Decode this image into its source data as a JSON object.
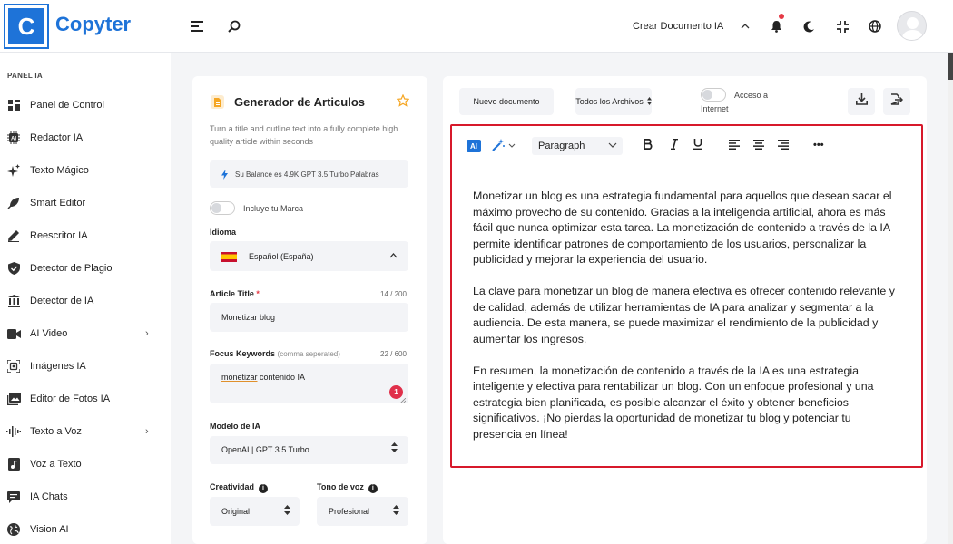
{
  "app": {
    "logo_letter": "C",
    "name": "Copyter"
  },
  "header": {
    "create_label": "Crear Documento IA"
  },
  "sidebar": {
    "section_label": "PANEL IA",
    "items": [
      {
        "label": "Panel de Control",
        "icon": "grid-icon"
      },
      {
        "label": "Redactor IA",
        "icon": "ai-chip-icon"
      },
      {
        "label": "Texto Mágico",
        "icon": "sparkle-icon"
      },
      {
        "label": "Smart Editor",
        "icon": "feather-icon"
      },
      {
        "label": "Reescritor IA",
        "icon": "pen-icon"
      },
      {
        "label": "Detector de Plagio",
        "icon": "shield-icon"
      },
      {
        "label": "Detector de IA",
        "icon": "building-icon"
      },
      {
        "label": "AI Video",
        "icon": "video-icon",
        "chevron": "›"
      },
      {
        "label": "Imágenes IA",
        "icon": "image-scan-icon"
      },
      {
        "label": "Editor de Fotos IA",
        "icon": "photo-icon"
      },
      {
        "label": "Texto a Voz",
        "icon": "waveform-icon",
        "chevron": "›"
      },
      {
        "label": "Voz a Texto",
        "icon": "music-file-icon"
      },
      {
        "label": "IA Chats",
        "icon": "chat-icon"
      },
      {
        "label": "Vision AI",
        "icon": "globe-icon"
      }
    ]
  },
  "form": {
    "title": "Generador de Articulos",
    "description": "Turn a title and outline text into a fully complete high quality article within seconds",
    "balance": "Su Balance es 4.9K GPT 3.5 Turbo Palabras",
    "brand_toggle_label": "Incluye tu Marca",
    "language_label": "Idioma",
    "language_value": "Español (España)",
    "title_label": "Article Title",
    "title_required": "*",
    "title_counter": "14 / 200",
    "title_value": "Monetizar blog",
    "keywords_label": "Focus Keywords",
    "keywords_hint": "(comma seperated)",
    "keywords_counter": "22 / 600",
    "keywords_value_underlined": "monetizar",
    "keywords_value_rest": " contenido IA",
    "keywords_badge": "1",
    "model_label": "Modelo de IA",
    "model_value": "OpenAI | GPT 3.5 Turbo",
    "creativity_label": "Creatividad",
    "creativity_value": "Original",
    "tone_label": "Tono de voz",
    "tone_value": "Profesional"
  },
  "editor": {
    "new_doc": "Nuevo documento",
    "all_files": "Todos los Archivos",
    "internet_label_1": "Acceso a",
    "internet_label_2": "Internet",
    "ai_chip": "AI",
    "paragraph_select": "Paragraph",
    "more": "•••",
    "paragraphs": [
      "Monetizar un blog es una estrategia fundamental para aquellos que desean sacar el máximo provecho de su contenido. Gracias a la inteligencia artificial, ahora es más fácil que nunca optimizar esta tarea. La monetización de contenido a través de la IA permite identificar patrones de comportamiento de los usuarios, personalizar la publicidad y mejorar la experiencia del usuario.",
      "La clave para monetizar un blog de manera efectiva es ofrecer contenido relevante y de calidad, además de utilizar herramientas de IA para analizar y segmentar a la audiencia. De esta manera, se puede maximizar el rendimiento de la publicidad y aumentar los ingresos.",
      "En resumen, la monetización de contenido a través de la IA es una estrategia inteligente y efectiva para rentabilizar un blog. Con un enfoque profesional y una estrategia bien planificada, es posible alcanzar el éxito y obtener beneficios significativos. ¡No pierdas la oportunidad de monetizar tu blog y potenciar tu presencia en línea!"
    ]
  },
  "colors": {
    "brand": "#1e73d8",
    "highlight": "#d7192b",
    "badge": "#e0304b"
  }
}
